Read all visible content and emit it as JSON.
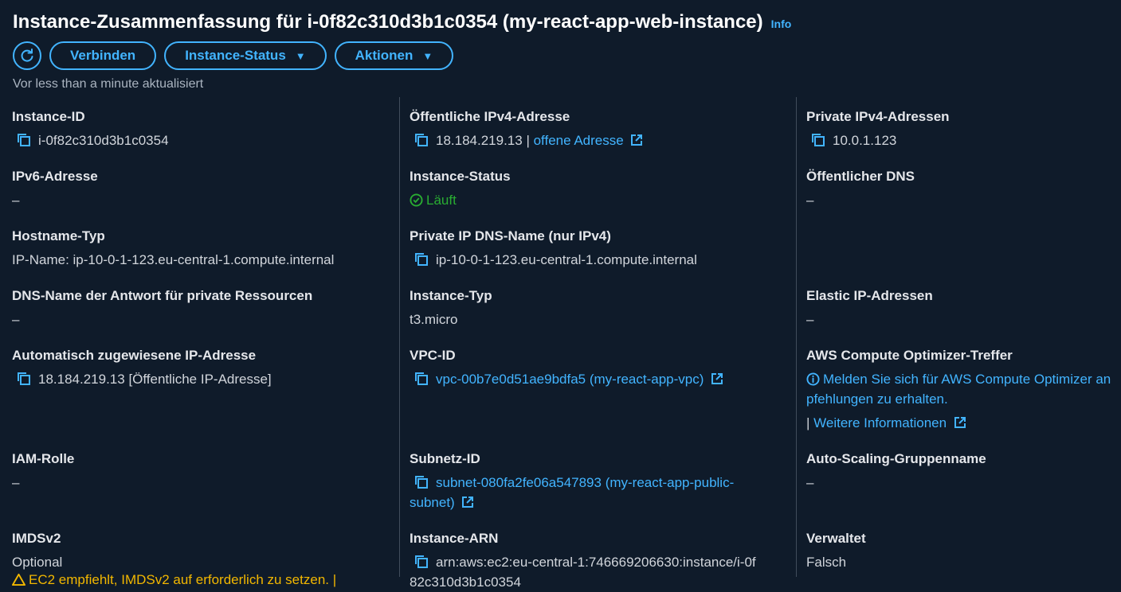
{
  "header": {
    "title": "Instance-Zusammenfassung für i-0f82c310d3b1c0354 (my-react-app-web-instance)",
    "info": "Info",
    "connect": "Verbinden",
    "instance_status_btn": "Instance-Status",
    "actions_btn": "Aktionen",
    "updated": "Vor less than a minute aktualisiert"
  },
  "fields": {
    "instance_id": {
      "label": "Instance-ID",
      "value": "i-0f82c310d3b1c0354"
    },
    "ipv6": {
      "label": "IPv6-Adresse",
      "value": "–"
    },
    "hostname_type": {
      "label": "Hostname-Typ",
      "value": "IP-Name: ip-10-0-1-123.eu-central-1.compute.internal"
    },
    "dns_answer": {
      "label": "DNS-Name der Antwort für private Ressourcen",
      "value": "–"
    },
    "auto_ip": {
      "label": "Automatisch zugewiesene IP-Adresse",
      "value": "18.184.219.13 [Öffentliche IP-Adresse]"
    },
    "iam": {
      "label": "IAM-Rolle",
      "value": "–"
    },
    "imds": {
      "label": "IMDSv2",
      "value": "Optional",
      "warning": "EC2 empfiehlt, IMDSv2 auf erforderlich zu setzen. |"
    },
    "public_ipv4": {
      "label": "Öffentliche IPv4-Adresse",
      "value": "18.184.219.13",
      "sep": " | ",
      "link": "offene Adresse"
    },
    "instance_status": {
      "label": "Instance-Status",
      "value": "Läuft"
    },
    "private_dns": {
      "label": "Private IP DNS-Name (nur IPv4)",
      "value": "ip-10-0-1-123.eu-central-1.compute.internal"
    },
    "instance_type": {
      "label": "Instance-Typ",
      "value": "t3.micro"
    },
    "vpc": {
      "label": "VPC-ID",
      "value": "vpc-00b7e0d51ae9bdfa5 (my-react-app-vpc)"
    },
    "subnet": {
      "label": "Subnetz-ID",
      "value_line1": "subnet-080fa2fe06a547893 (my-react-app-public-",
      "value_line2": "subnet)"
    },
    "arn": {
      "label": "Instance-ARN",
      "value_line1": "arn:aws:ec2:eu-central-1:746669206630:instance/i-0f",
      "value_line2": "82c310d3b1c0354"
    },
    "private_ipv4": {
      "label": "Private IPv4-Adressen",
      "value": "10.0.1.123"
    },
    "public_dns": {
      "label": "Öffentlicher DNS",
      "value": "–"
    },
    "elastic_ip": {
      "label": "Elastic IP-Adressen",
      "value": "–"
    },
    "optimizer": {
      "label": "AWS Compute Optimizer-Treffer",
      "line1": "Melden Sie sich für AWS Compute Optimizer an",
      "line2": "pfehlungen zu erhalten.",
      "more_sep": "| ",
      "more": "Weitere Informationen"
    },
    "asg": {
      "label": "Auto-Scaling-Gruppenname",
      "value": "–"
    },
    "managed": {
      "label": "Verwaltet",
      "value": "Falsch"
    }
  },
  "colors": {
    "background": "#0f1b2a",
    "accent": "#42b4ff",
    "success": "#29ad32",
    "warning": "#f2b700",
    "divider": "#414d5c"
  }
}
